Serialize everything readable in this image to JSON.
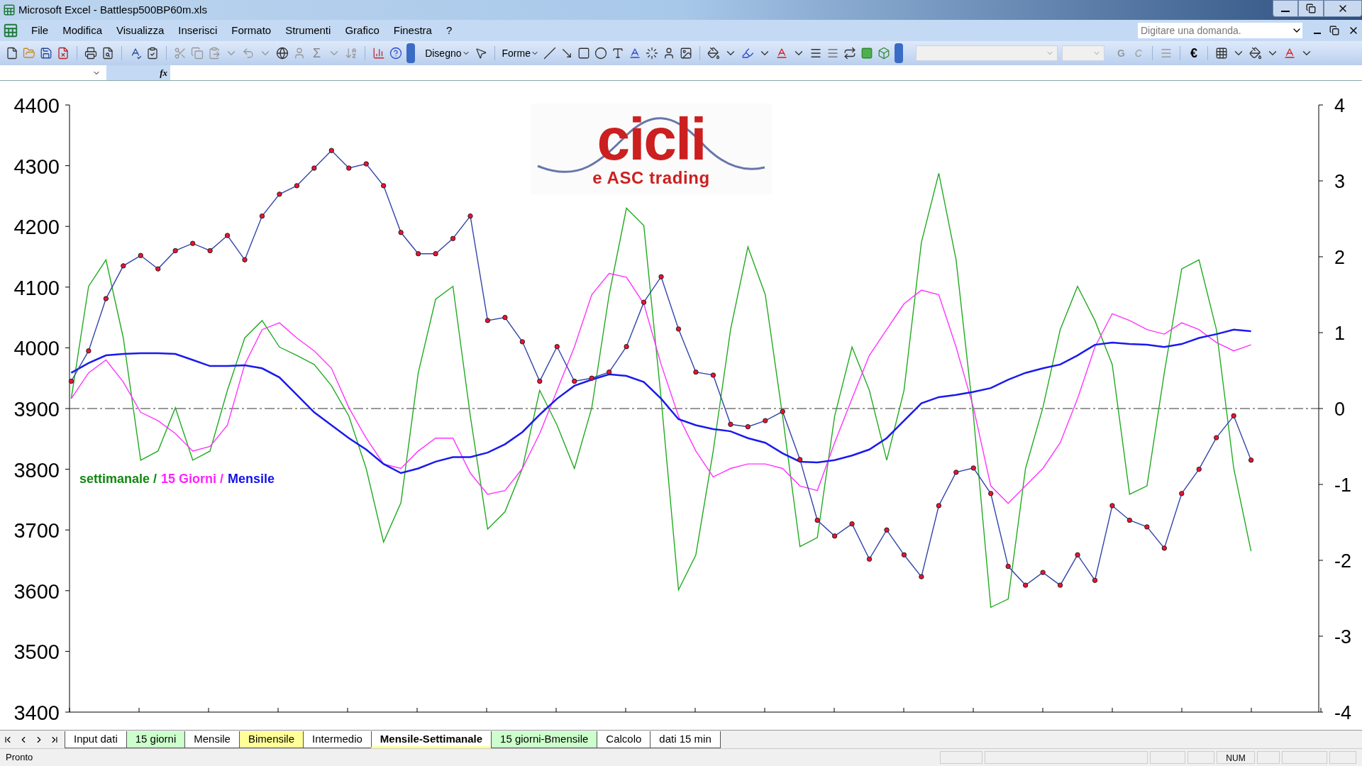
{
  "window": {
    "title": "Microsoft Excel - Battlesp500BP60m.xls"
  },
  "menu": [
    "File",
    "Modifica",
    "Visualizza",
    "Inserisci",
    "Formato",
    "Strumenti",
    "Grafico",
    "Finestra",
    "?"
  ],
  "help_box": {
    "placeholder": "Digitare una domanda."
  },
  "toolbar": {
    "sum": "Σ",
    "drawing_menu": "Disegno",
    "shapes_menu": "Forme",
    "bold": "G",
    "italic": "C",
    "euro": "€"
  },
  "formula_bar": {
    "fx": "fx"
  },
  "chart": {
    "logo": {
      "title": "cicli",
      "subtitle": "e ASC trading"
    },
    "legend_text": [
      {
        "text": "settimanale /",
        "color": "#118811"
      },
      {
        "text": "15 Giorni /",
        "color": "#ff22ff"
      },
      {
        "text": "Mensile",
        "color": "#1111ee"
      }
    ],
    "price": {
      "chart_data": {
        "type": "line",
        "ylim": [
          3400,
          4400
        ],
        "yticks": [
          3400,
          3500,
          3600,
          3700,
          3800,
          3900,
          4000,
          4100,
          4200,
          4300,
          4400
        ],
        "categories": [
          null,
          null,
          null,
          null,
          null,
          null,
          null,
          null,
          null,
          null,
          null,
          null,
          null,
          null,
          null,
          null,
          null,
          null,
          null,
          null,
          null,
          null,
          null,
          null,
          null,
          null,
          null,
          null,
          null,
          null,
          null,
          null,
          null,
          null,
          null,
          null,
          null,
          null,
          null,
          null,
          null,
          null,
          null,
          null,
          null,
          null,
          null,
          null,
          null,
          null,
          null,
          null,
          null,
          null,
          null,
          null,
          null,
          null,
          null,
          null,
          null,
          null,
          null,
          null,
          null,
          null,
          null,
          null,
          null
        ],
        "series": [
          {
            "color": "#3344aa",
            "marker": true,
            "values": [
              3945,
              3995,
              4081,
              4135,
              4152,
              4130,
              4160,
              4172,
              4160,
              4185,
              4145,
              4217,
              4253,
              4267,
              4296,
              4325,
              4296,
              4303,
              4267,
              4190,
              4155,
              4155,
              4180,
              4217,
              4045,
              4050,
              4010,
              3945,
              4002,
              3945,
              3950,
              3960,
              4002,
              4075,
              4117,
              4031,
              3960,
              3955,
              3874,
              3870,
              3880,
              3895,
              3816,
              3716,
              3690,
              3710,
              3652,
              3700,
              3659,
              3623,
              3740,
              3795,
              3802,
              3760,
              3640,
              3609,
              3630,
              3609,
              3659,
              3617,
              3740,
              3716,
              3705,
              3670,
              3760,
              3800,
              3852,
              3888,
              3815
            ]
          }
        ]
      }
    },
    "oscillators": {
      "chart_data": {
        "type": "line",
        "ylim": [
          -4,
          4
        ],
        "yticks": [
          -4,
          -3,
          -2,
          -1,
          0,
          1,
          2,
          3,
          4
        ],
        "categories": [
          null,
          null,
          null,
          null,
          null,
          null,
          null,
          null,
          null,
          null,
          null,
          null,
          null,
          null,
          null,
          null,
          null,
          null,
          null,
          null,
          null,
          null,
          null,
          null,
          null,
          null,
          null,
          null,
          null,
          null,
          null,
          null,
          null,
          null,
          null,
          null,
          null,
          null,
          null,
          null,
          null,
          null,
          null,
          null,
          null,
          null,
          null,
          null,
          null,
          null,
          null,
          null,
          null,
          null,
          null,
          null,
          null,
          null,
          null,
          null,
          null,
          null,
          null,
          null,
          null,
          null,
          null,
          null,
          null
        ],
        "series": [
          {
            "color": "#22aa22",
            "values": [
              0.13,
              1.61,
              1.96,
              0.93,
              -0.68,
              -0.56,
              0.01,
              -0.68,
              -0.56,
              0.24,
              0.93,
              1.16,
              0.81,
              0.7,
              0.58,
              0.3,
              -0.1,
              -0.79,
              -1.76,
              -1.24,
              0.47,
              1.44,
              1.61,
              -0.1,
              -1.59,
              -1.36,
              -0.79,
              0.24,
              -0.22,
              -0.79,
              0.01,
              1.5,
              2.64,
              2.41,
              0.13,
              -2.39,
              -1.93,
              -0.56,
              1.04,
              2.13,
              1.5,
              -0.1,
              -1.82,
              -1.7,
              -0.1,
              0.81,
              0.24,
              -0.68,
              0.24,
              2.19,
              3.1,
              1.96,
              -0.1,
              -2.62,
              -2.51,
              -0.79,
              0.01,
              1.04,
              1.61,
              1.16,
              0.58,
              -1.13,
              -1.02,
              0.47,
              1.84,
              1.96,
              1.04,
              -0.79,
              -1.88
            ]
          },
          {
            "color": "#ff33ff",
            "values": [
              0.13,
              0.47,
              0.64,
              0.35,
              -0.05,
              -0.16,
              -0.33,
              -0.56,
              -0.5,
              -0.22,
              0.58,
              1.04,
              1.13,
              0.93,
              0.76,
              0.53,
              0.01,
              -0.39,
              -0.73,
              -0.79,
              -0.56,
              -0.39,
              -0.39,
              -0.85,
              -1.13,
              -1.08,
              -0.79,
              -0.33,
              0.24,
              0.81,
              1.5,
              1.78,
              1.73,
              1.38,
              0.58,
              -0.1,
              -0.56,
              -0.9,
              -0.79,
              -0.73,
              -0.73,
              -0.79,
              -1.02,
              -1.08,
              -0.45,
              0.13,
              0.7,
              1.04,
              1.38,
              1.56,
              1.5,
              0.81,
              0.01,
              -1.02,
              -1.25,
              -1.02,
              -0.79,
              -0.45,
              0.13,
              0.81,
              1.25,
              1.16,
              1.04,
              0.98,
              1.13,
              1.04,
              0.87,
              0.76,
              0.84
            ]
          },
          {
            "color": "#1a1aee",
            "values": [
              0.47,
              0.6,
              0.7,
              0.72,
              0.73,
              0.73,
              0.72,
              0.64,
              0.56,
              0.56,
              0.57,
              0.53,
              0.41,
              0.18,
              -0.05,
              -0.22,
              -0.39,
              -0.54,
              -0.73,
              -0.85,
              -0.79,
              -0.7,
              -0.64,
              -0.64,
              -0.58,
              -0.47,
              -0.31,
              -0.08,
              0.13,
              0.3,
              0.38,
              0.45,
              0.43,
              0.35,
              0.13,
              -0.14,
              -0.22,
              -0.27,
              -0.3,
              -0.39,
              -0.45,
              -0.59,
              -0.7,
              -0.71,
              -0.68,
              -0.62,
              -0.54,
              -0.39,
              -0.16,
              0.07,
              0.15,
              0.18,
              0.22,
              0.27,
              0.38,
              0.47,
              0.53,
              0.58,
              0.7,
              0.84,
              0.87,
              0.85,
              0.84,
              0.81,
              0.85,
              0.93,
              0.98,
              1.04,
              1.02
            ]
          }
        ]
      }
    }
  },
  "sheet_tabs": [
    {
      "label": "Input dati",
      "selected": false,
      "color": "#ffffff"
    },
    {
      "label": "15 giorni",
      "selected": false,
      "color": "#ccffcc"
    },
    {
      "label": "Mensile",
      "selected": false,
      "color": "#ffffff"
    },
    {
      "label": "Bimensile",
      "selected": false,
      "color": "#ffff99"
    },
    {
      "label": "Intermedio",
      "selected": false,
      "color": "#ffffff"
    },
    {
      "label": "Mensile-Settimanale",
      "selected": true,
      "color": "#ffff99"
    },
    {
      "label": "15 giorni-Bmensile",
      "selected": false,
      "color": "#ccffcc"
    },
    {
      "label": "Calcolo",
      "selected": false,
      "color": "#ffffff"
    },
    {
      "label": "dati 15 min",
      "selected": false,
      "color": "#ffffff"
    }
  ],
  "status_bar": {
    "text": "Pronto",
    "num": "NUM"
  }
}
